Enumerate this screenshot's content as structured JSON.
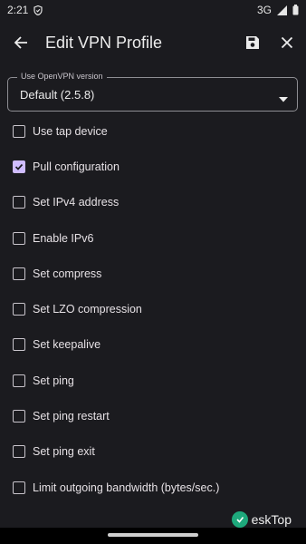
{
  "status_bar": {
    "time": "2:21",
    "network": "3G"
  },
  "app_bar": {
    "title": "Edit VPN Profile"
  },
  "openvpn_version": {
    "label": "Use OpenVPN version",
    "value": "Default (2.5.8)"
  },
  "options": [
    {
      "label": "Use tap device",
      "checked": false
    },
    {
      "label": "Pull configuration",
      "checked": true
    },
    {
      "label": "Set IPv4 address",
      "checked": false
    },
    {
      "label": "Enable IPv6",
      "checked": false
    },
    {
      "label": "Set compress",
      "checked": false
    },
    {
      "label": "Set LZO compression",
      "checked": false
    },
    {
      "label": "Set keepalive",
      "checked": false
    },
    {
      "label": "Set ping",
      "checked": false
    },
    {
      "label": "Set ping restart",
      "checked": false
    },
    {
      "label": "Set ping exit",
      "checked": false
    },
    {
      "label": "Limit outgoing bandwidth (bytes/sec.)",
      "checked": false
    }
  ],
  "watermark": {
    "text": "eskTop"
  },
  "colors": {
    "background": "#1b1b1f",
    "accent": "#cfbcff",
    "text": "#e6e1e5"
  }
}
